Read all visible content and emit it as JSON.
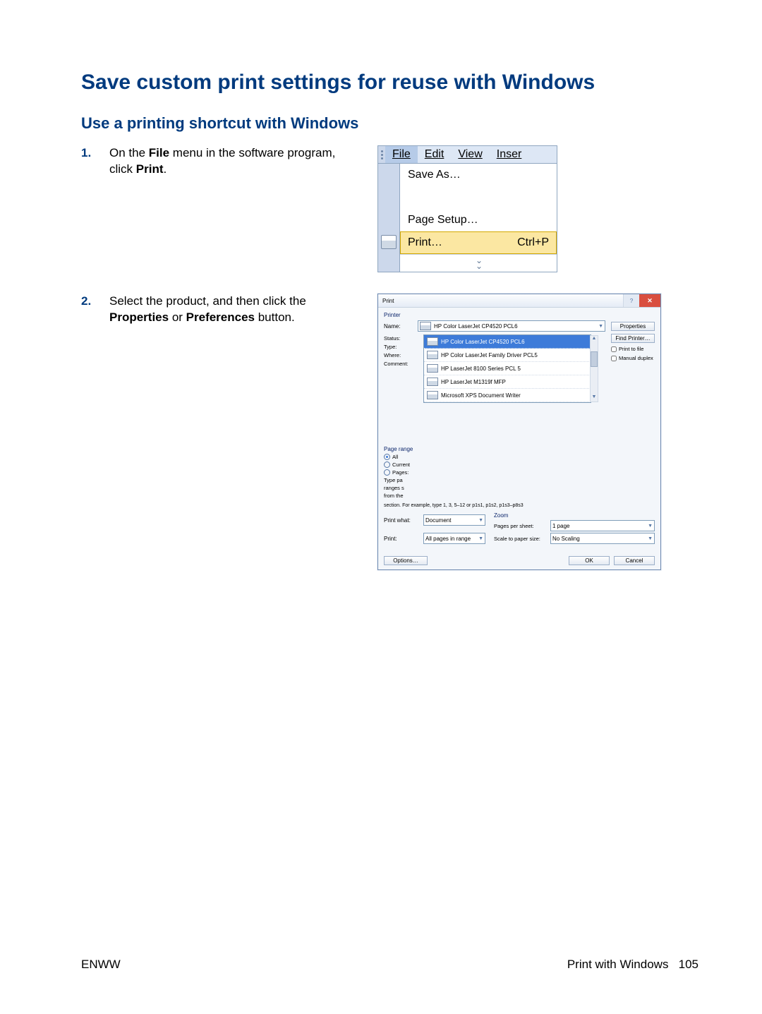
{
  "heading": "Save custom print settings for reuse with Windows",
  "subheading": "Use a printing shortcut with Windows",
  "steps": [
    {
      "num": "1.",
      "text_pre": "On the ",
      "bold1": "File",
      "text_mid": " menu in the software program, click ",
      "bold2": "Print",
      "text_end": "."
    },
    {
      "num": "2.",
      "text_pre": "Select the product, and then click the ",
      "bold1": "Properties",
      "text_mid": " or ",
      "bold2": "Preferences",
      "text_end": " button."
    }
  ],
  "fig1": {
    "menubar": [
      "File",
      "Edit",
      "View",
      "Inser"
    ],
    "items": {
      "save_as": "Save As…",
      "page_setup": "Page Setup…",
      "print": "Print…",
      "shortcut": "Ctrl+P"
    }
  },
  "fig2": {
    "title": "Print",
    "printer_group": "Printer",
    "name_label": "Name:",
    "name_value": "HP Color LaserJet CP4520 PCL6",
    "status_label": "Status:",
    "type_label": "Type:",
    "where_label": "Where:",
    "comment_label": "Comment:",
    "side_buttons": {
      "properties": "Properties",
      "find_printer": "Find Printer…",
      "print_to_file": "Print to file",
      "manual_duplex": "Manual duplex"
    },
    "dropdown": [
      "HP Color LaserJet CP4520 PCL6",
      "HP Color LaserJet Family Driver PCL5",
      "HP LaserJet 8100 Series PCL 5",
      "HP LaserJet M1319f MFP",
      "Microsoft XPS Document Writer"
    ],
    "page_range_group": "Page range",
    "all": "All",
    "current": "Current",
    "pages": "Pages:",
    "type_hint1": "Type pa",
    "type_hint2": "ranges s",
    "type_hint3": "from the",
    "type_note": "section. For example, type 1, 3, 5–12 or p1s1, p1s2, p1s3–p8s3",
    "print_what_label": "Print what:",
    "print_what_value": "Document",
    "print_label": "Print:",
    "print_value": "All pages in range",
    "zoom_group": "Zoom",
    "pps_label": "Pages per sheet:",
    "pps_value": "1 page",
    "scale_label": "Scale to paper size:",
    "scale_value": "No Scaling",
    "options": "Options…",
    "ok": "OK",
    "cancel": "Cancel"
  },
  "footer": {
    "left": "ENWW",
    "right_text": "Print with Windows",
    "right_page": "105"
  }
}
